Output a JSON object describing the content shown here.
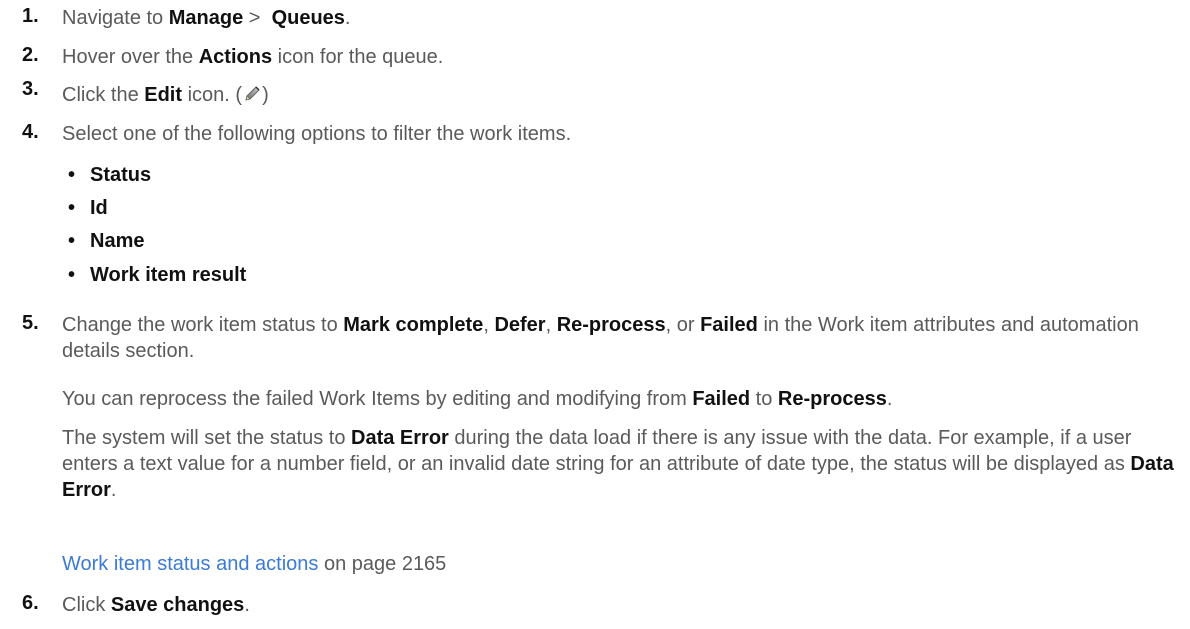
{
  "steps": [
    {
      "number": "1.",
      "pre": "Navigate to ",
      "b1": "Manage",
      "mid": " >  ",
      "b2": "Queues",
      "post": "."
    },
    {
      "number": "2.",
      "pre": "Hover over the ",
      "b1": "Actions",
      "post": " icon for the queue."
    },
    {
      "number": "3.",
      "pre": "Click the ",
      "b1": "Edit",
      "post": " icon. (",
      "icon": "pencil-edit-icon",
      "close": ")"
    },
    {
      "number": "4.",
      "text": "Select one of the following options to filter the work items.",
      "bullets": [
        "Status",
        "Id",
        "Name",
        "Work item result"
      ]
    },
    {
      "number": "5.",
      "pre": "Change the work item status to ",
      "b1": "Mark complete",
      "s1": ", ",
      "b2": "Defer",
      "s2": ", ",
      "b3": "Re-process",
      "s3": ", or ",
      "b4": "Failed",
      "post": " in the Work item attributes and automation details section.",
      "para1": {
        "pre": "You can reprocess the failed Work Items by editing and modifying from ",
        "b1": "Failed",
        "mid": " to ",
        "b2": "Re-process",
        "post": "."
      },
      "para2": {
        "pre": "The system will set the status to ",
        "b1": "Data Error",
        "mid": " during the data load if there is any issue with the data. For example, if a user enters a text value for a number field, or an invalid date string for an attribute of date type, the status will be displayed as ",
        "b2": "Data Error",
        "post": "."
      },
      "link": {
        "text": "Work item status and actions",
        "suffix": " on page 2165"
      }
    },
    {
      "number": "6.",
      "pre": "Click ",
      "b1": "Save changes",
      "post": "."
    }
  ],
  "colors": {
    "text": "#5a5a5a",
    "bold": "#111111",
    "link": "#3b7bd6"
  }
}
